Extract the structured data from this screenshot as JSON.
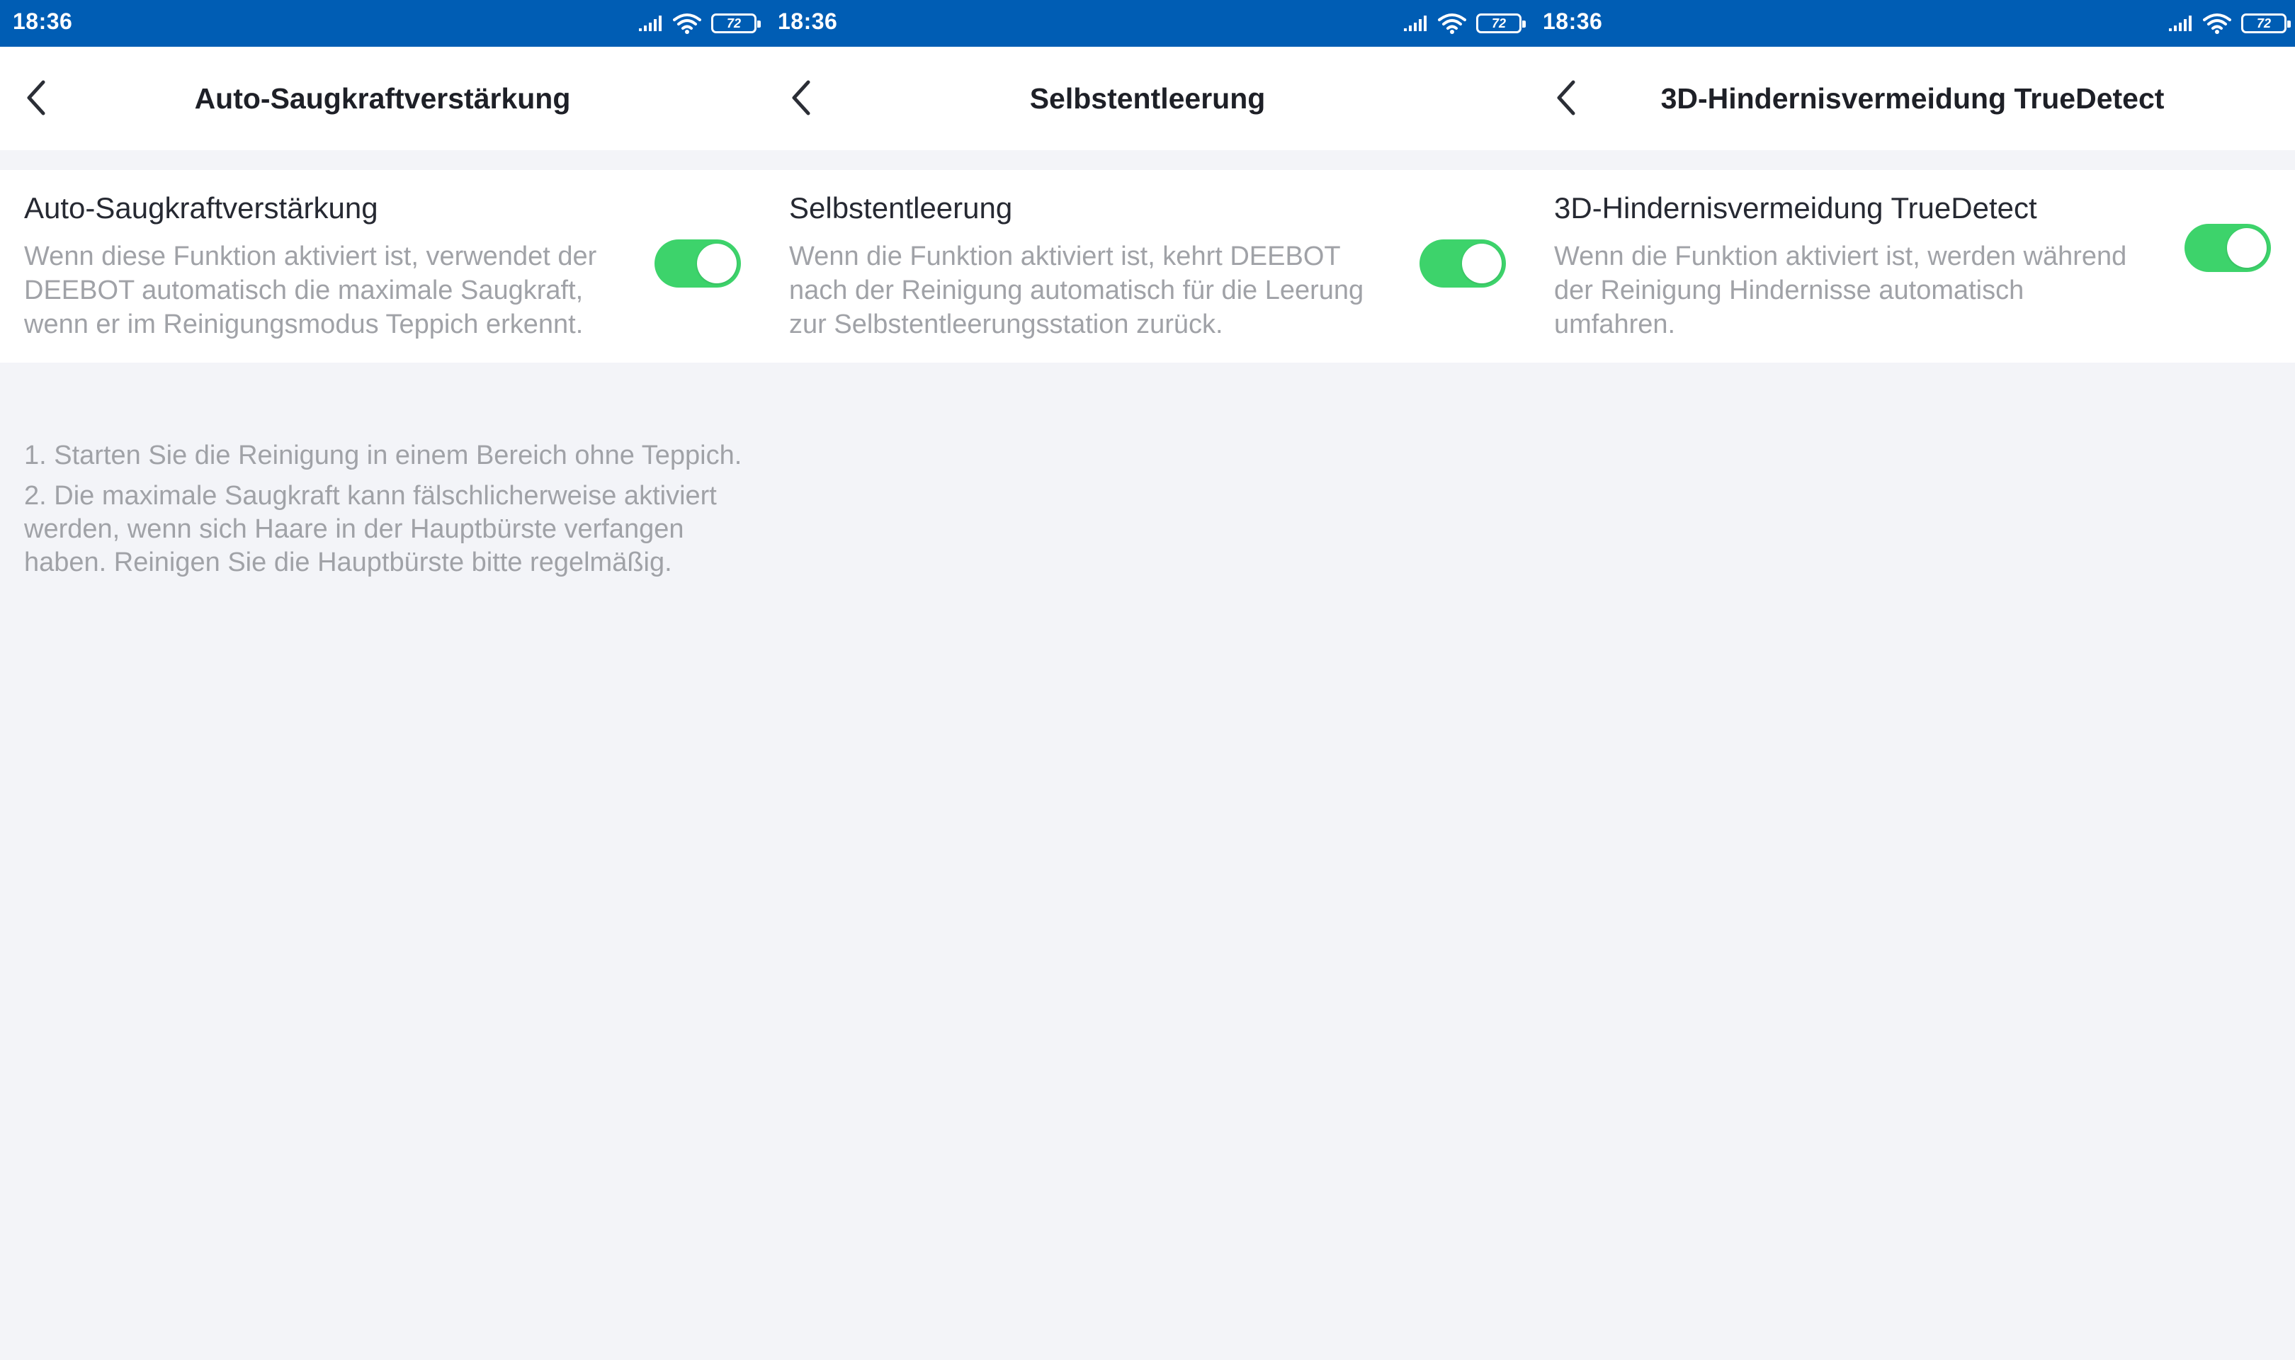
{
  "status_bar": {
    "time": "18:36",
    "battery": "72",
    "signal_icon": "signal-icon",
    "wifi_icon": "wifi-icon"
  },
  "screens": [
    {
      "header_title": "Auto-Saugkraftverstärkung",
      "setting_title": "Auto-Saugkraftverstärkung",
      "setting_desc": "Wenn diese Funktion aktiviert ist, verwendet der DEEBOT automatisch die maximale Saugkraft, wenn er im Reinigungsmodus Teppich erkennt.",
      "toggle_on": true,
      "notes": [
        "1. Starten Sie die Reinigung in einem Bereich ohne Teppich.",
        "2. Die maximale Saugkraft kann fälschlicherweise aktiviert werden, wenn sich Haare in der Hauptbürste verfangen haben. Reinigen Sie die Hauptbürste bitte regelmäßig."
      ]
    },
    {
      "header_title": "Selbstentleerung",
      "setting_title": "Selbstentleerung",
      "setting_desc": "Wenn die Funktion aktiviert ist, kehrt DEEBOT nach der Reinigung automatisch für die Leerung zur Selbstentleerungsstation zurück.",
      "toggle_on": true
    },
    {
      "header_title": "3D-Hindernisvermeidung TrueDetect",
      "setting_title": "3D-Hindernisvermeidung TrueDetect",
      "setting_desc": "Wenn die Funktion aktiviert ist, werden während der Reinigung Hindernisse automatisch umfahren.",
      "toggle_on": true
    }
  ],
  "colors": {
    "status_bar": "#005db4",
    "toggle_on": "#3dd36b",
    "background": "#f3f4f8",
    "secondary_text": "#a0a2a7"
  }
}
